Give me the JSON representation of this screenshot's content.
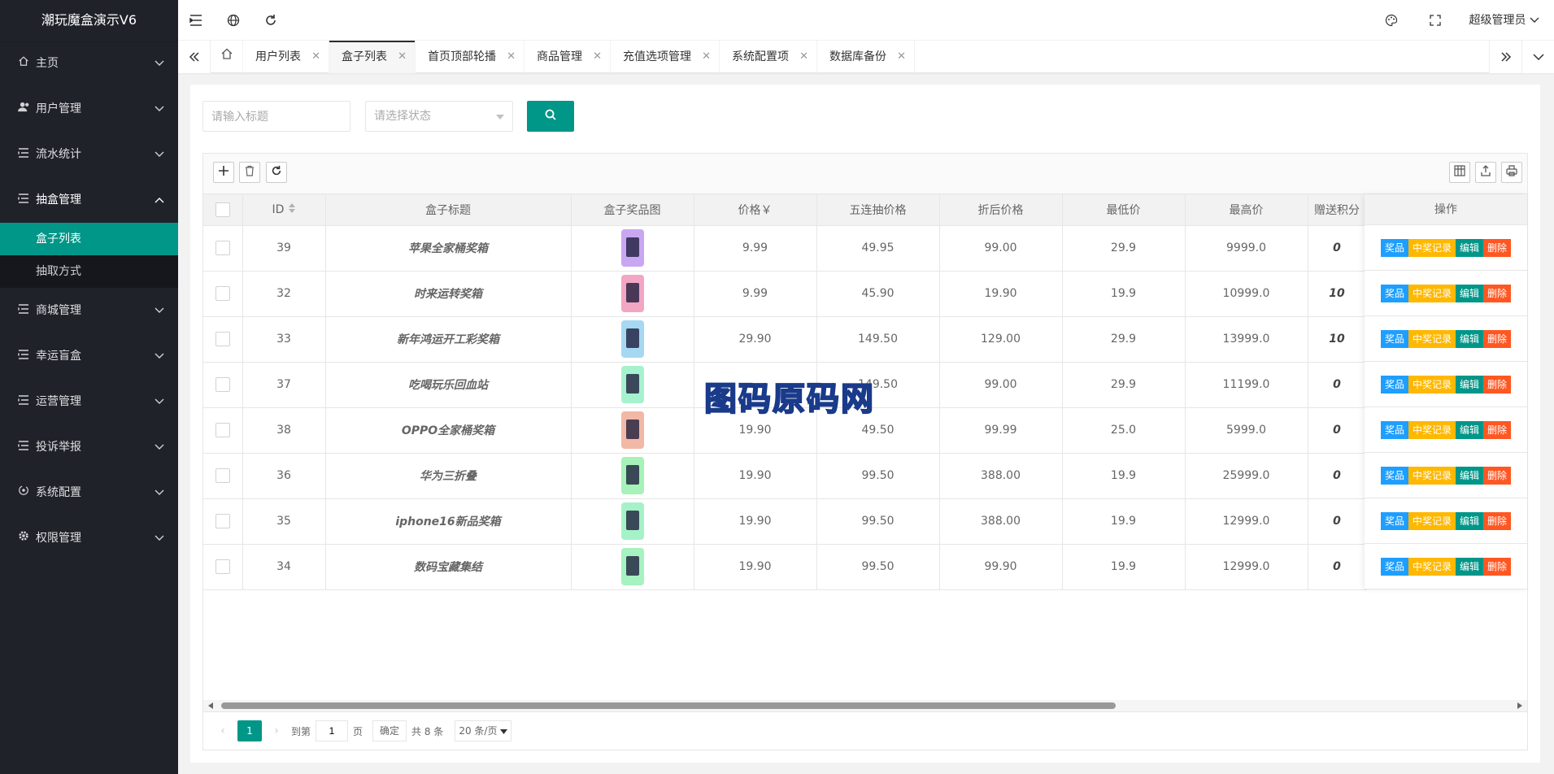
{
  "app": {
    "title": "潮玩魔盒演示V6"
  },
  "sidebar": {
    "items": [
      {
        "label": "主页",
        "icon": "home-icon"
      },
      {
        "label": "用户管理",
        "icon": "users-icon"
      },
      {
        "label": "流水统计",
        "icon": "list-icon"
      },
      {
        "label": "抽盒管理",
        "icon": "list-icon",
        "open": true,
        "children": [
          {
            "label": "盒子列表",
            "active": true
          },
          {
            "label": "抽取方式"
          }
        ]
      },
      {
        "label": "商城管理",
        "icon": "list-icon"
      },
      {
        "label": "幸运盲盒",
        "icon": "list-icon"
      },
      {
        "label": "运营管理",
        "icon": "list-icon"
      },
      {
        "label": "投诉举报",
        "icon": "list-icon"
      },
      {
        "label": "系统配置",
        "icon": "settings-icon"
      },
      {
        "label": "权限管理",
        "icon": "gear-icon"
      }
    ]
  },
  "header": {
    "user": "超级管理员"
  },
  "tabs": [
    {
      "label": "用户列表"
    },
    {
      "label": "盒子列表",
      "active": true
    },
    {
      "label": "首页顶部轮播"
    },
    {
      "label": "商品管理"
    },
    {
      "label": "充值选项管理"
    },
    {
      "label": "系统配置项"
    },
    {
      "label": "数据库备份"
    }
  ],
  "filter": {
    "title_placeholder": "请输入标题",
    "status_placeholder": "请选择状态"
  },
  "table": {
    "columns": [
      "ID",
      "盒子标题",
      "盒子奖品图",
      "价格￥",
      "五连抽价格",
      "折后价格",
      "最低价",
      "最高价",
      "赠送积分"
    ],
    "ops_header": "操作",
    "ops": {
      "prize": "奖品",
      "record": "中奖记录",
      "edit": "编辑",
      "delete": "删除"
    },
    "rows": [
      {
        "id": "39",
        "title": "苹果全家桶奖箱",
        "price": "9.99",
        "five": "49.95",
        "discount": "99.00",
        "min": "29.9",
        "max": "9999.0",
        "points": "0",
        "thumb": "#c9a6f2"
      },
      {
        "id": "32",
        "title": "时来运转奖箱",
        "price": "9.99",
        "five": "45.90",
        "discount": "19.90",
        "min": "19.9",
        "max": "10999.0",
        "points": "10",
        "thumb": "#f2a6c4"
      },
      {
        "id": "33",
        "title": "新年鸿运开工彩奖箱",
        "price": "29.90",
        "five": "149.50",
        "discount": "129.00",
        "min": "29.9",
        "max": "13999.0",
        "points": "10",
        "thumb": "#a6d8f2"
      },
      {
        "id": "37",
        "title": "吃喝玩乐回血站",
        "price": "",
        "five": "149.50",
        "discount": "99.00",
        "min": "29.9",
        "max": "11199.0",
        "points": "0",
        "thumb": "#a6f2cf"
      },
      {
        "id": "38",
        "title": "OPPO全家桶奖箱",
        "price": "19.90",
        "five": "49.50",
        "discount": "99.99",
        "min": "25.0",
        "max": "5999.0",
        "points": "0",
        "thumb": "#f2b8a6"
      },
      {
        "id": "36",
        "title": "华为三折叠",
        "price": "19.90",
        "five": "99.50",
        "discount": "388.00",
        "min": "19.9",
        "max": "25999.0",
        "points": "0",
        "thumb": "#a6f2b8"
      },
      {
        "id": "35",
        "title": "iphone16新品奖箱",
        "price": "19.90",
        "five": "99.50",
        "discount": "388.00",
        "min": "19.9",
        "max": "12999.0",
        "points": "0",
        "thumb": "#a6f2c8"
      },
      {
        "id": "34",
        "title": "数码宝藏集结",
        "price": "19.90",
        "five": "99.50",
        "discount": "99.90",
        "min": "19.9",
        "max": "12999.0",
        "points": "0",
        "thumb": "#a6f2c0"
      }
    ]
  },
  "pager": {
    "current": "1",
    "goto_label": "到第",
    "page_input": "1",
    "page_label": "页",
    "confirm": "确定",
    "total": "共 8 条",
    "size": "20 条/页"
  },
  "watermark": "图码原码网"
}
